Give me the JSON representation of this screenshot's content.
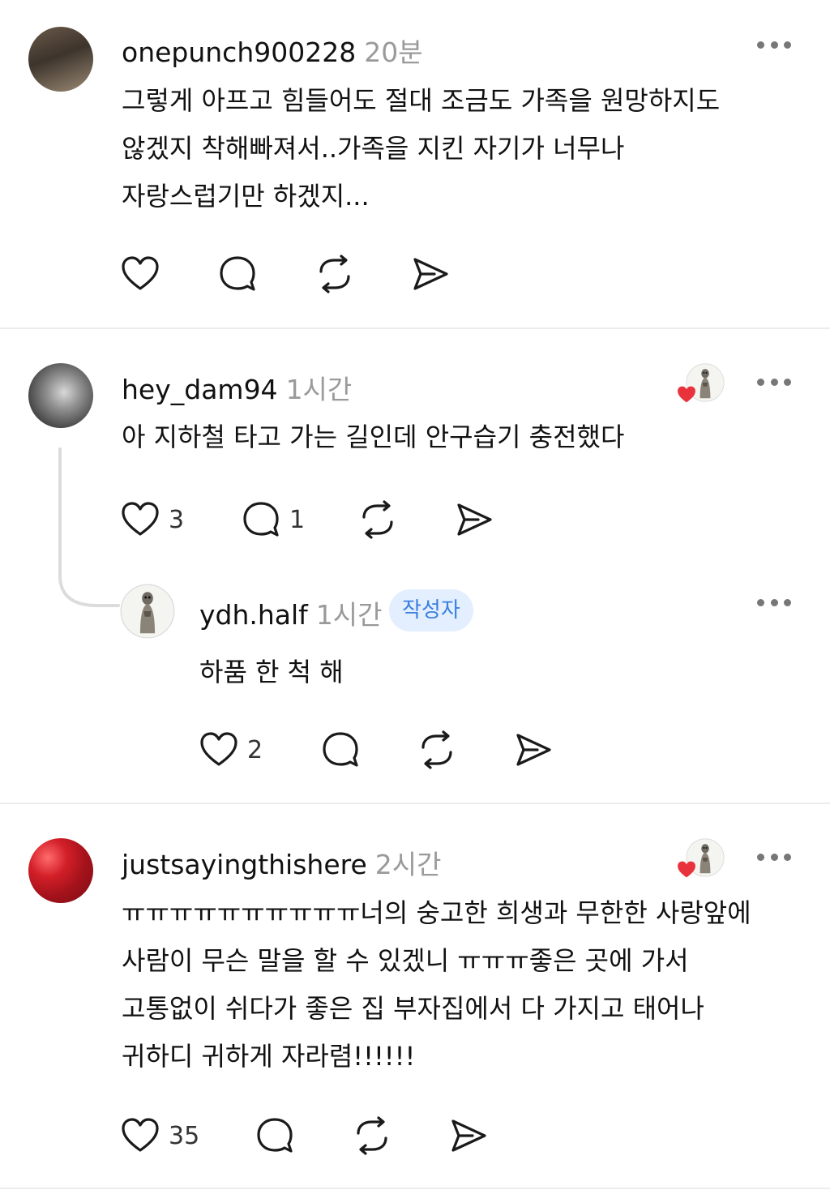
{
  "comments": [
    {
      "username": "onepunch900228",
      "time": "20분",
      "lines": [
        "그렇게 아프고 힘들어도 절대 조금도 가족을 원망하지도",
        "않겠지 착해빠져서..가족을 지킨 자기가 너무나",
        "자랑스럽기만 하겠지..."
      ],
      "likes": "",
      "replies": ""
    },
    {
      "username": "hey_dam94",
      "time": "1시간",
      "lines": [
        "아 지하철 타고 가는 길인데 안구습기 충전했다"
      ],
      "likes": "3",
      "replies": "1"
    },
    {
      "username": "ydh.half",
      "time": "1시간",
      "badge": "작성자",
      "lines": [
        "하품 한 척 해"
      ],
      "likes": "2",
      "replies": ""
    },
    {
      "username": "justsayingthishere",
      "time": "2시간",
      "lines": [
        "ㅠㅠㅠㅠㅠㅠㅠㅠㅠㅠ너의 숭고한 희생과 무한한 사랑앞에",
        "사람이 무슨 말을 할 수 있겠니 ㅠㅠㅠ좋은 곳에 가서",
        "고통없이 쉬다가 좋은 집 부자집에서 다 가지고 태어나",
        "귀하디 귀하게 자라렴!!!!!!"
      ],
      "likes": "35",
      "replies": ""
    }
  ],
  "colors": {
    "heart": "#e8333c",
    "badge_bg": "#e3efff",
    "badge_text": "#3a7fe0",
    "meta": "#9a9a9a"
  }
}
